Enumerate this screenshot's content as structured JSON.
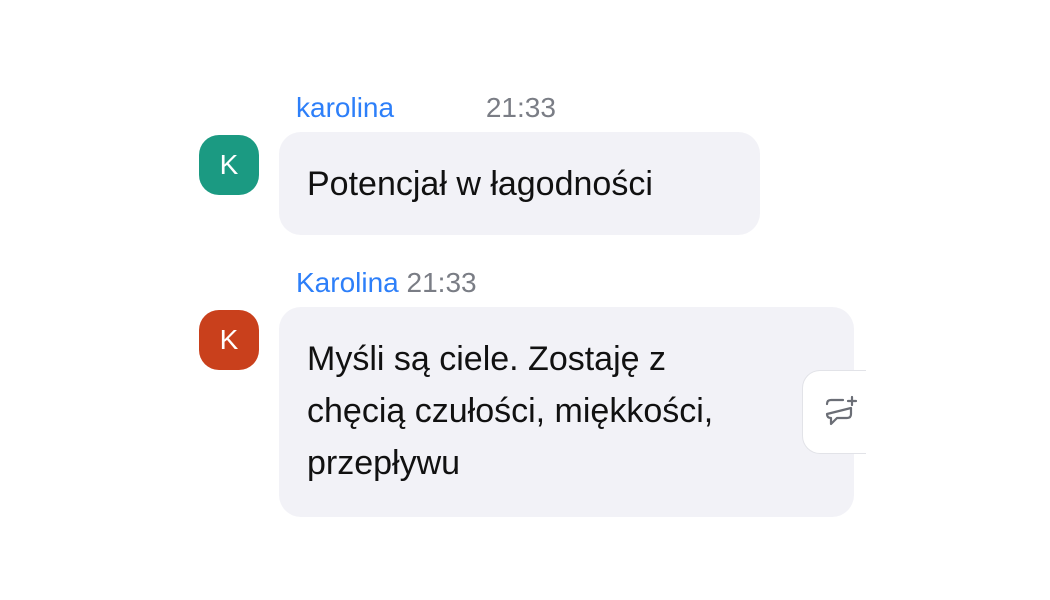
{
  "messages": [
    {
      "author": "karolina",
      "time": "21:33",
      "avatar_letter": "K",
      "avatar_color": "#1b9a82",
      "text": "Potencjał w łagodności"
    },
    {
      "author": "Karolina",
      "time": "21:33",
      "avatar_letter": "K",
      "avatar_color": "#c9401c",
      "text_lines": [
        "Myśli są ciele. Zostaję z",
        "chęcią czułości, miękkości,",
        "przepływu"
      ]
    }
  ],
  "actions": {
    "reply_icon": "chat-bubble-plus-icon"
  },
  "colors": {
    "author_name": "#2d7ff9",
    "timestamp": "#7a7d85",
    "bubble_background": "#f2f2f7"
  }
}
